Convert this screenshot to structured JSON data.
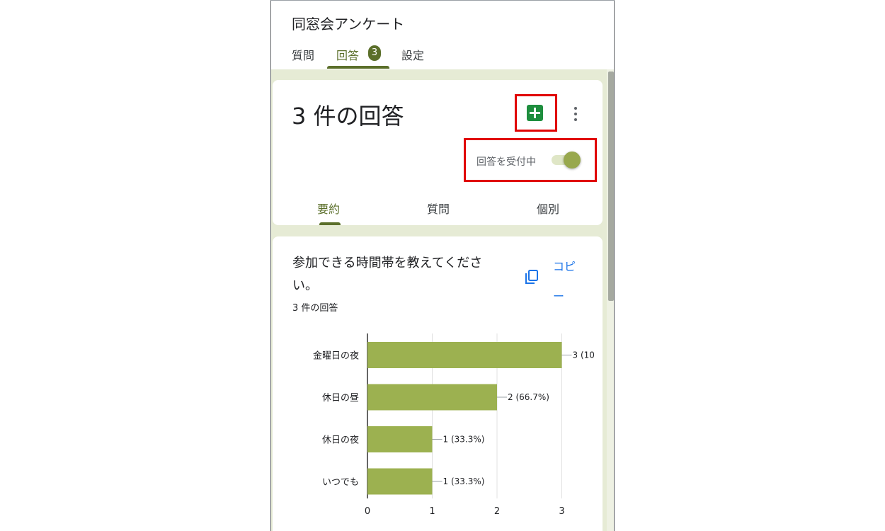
{
  "form_title": "同窓会アンケート",
  "top_tabs": [
    {
      "label": "質問"
    },
    {
      "label": "回答",
      "badge": "3"
    },
    {
      "label": "設定"
    }
  ],
  "summary_card": {
    "title": "3 件の回答",
    "sheets_icon": "google-sheets-icon",
    "more_icon": "more-vert-icon",
    "accepting_label": "回答を受付中",
    "accepting": true,
    "subtabs": [
      "要約",
      "質問",
      "個別"
    ],
    "highlight_color": "#e00000"
  },
  "question_card": {
    "title": "参加できる時間帯を教えてください。",
    "response_count": "3 件の回答",
    "copy_label": "コピー",
    "copy_icon": "copy-icon"
  },
  "chart_data": {
    "type": "bar",
    "orientation": "horizontal",
    "categories": [
      "金曜日の夜",
      "休日の昼",
      "休日の夜",
      "いつでも"
    ],
    "values": [
      3,
      2,
      1,
      1
    ],
    "value_labels": [
      "3 (10",
      "2 (66.7%)",
      "1 (33.3%)",
      "1 (33.3%)"
    ],
    "x_ticks": [
      "0",
      "1",
      "2",
      "3"
    ],
    "xlim": [
      0,
      3
    ],
    "bar_color": "#9cb150",
    "grid": true
  },
  "colors": {
    "accent": "#5b6f2a",
    "bar": "#9cb150",
    "link": "#1a73e8",
    "page_bg": "#e6ebd5"
  }
}
